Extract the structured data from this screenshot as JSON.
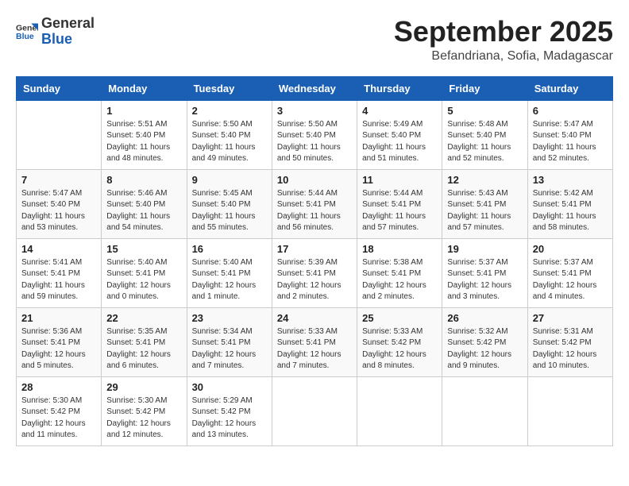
{
  "logo": {
    "general": "General",
    "blue": "Blue"
  },
  "title": "September 2025",
  "subtitle": "Befandriana, Sofia, Madagascar",
  "headers": [
    "Sunday",
    "Monday",
    "Tuesday",
    "Wednesday",
    "Thursday",
    "Friday",
    "Saturday"
  ],
  "weeks": [
    [
      {
        "day": "",
        "info": ""
      },
      {
        "day": "1",
        "info": "Sunrise: 5:51 AM\nSunset: 5:40 PM\nDaylight: 11 hours\nand 48 minutes."
      },
      {
        "day": "2",
        "info": "Sunrise: 5:50 AM\nSunset: 5:40 PM\nDaylight: 11 hours\nand 49 minutes."
      },
      {
        "day": "3",
        "info": "Sunrise: 5:50 AM\nSunset: 5:40 PM\nDaylight: 11 hours\nand 50 minutes."
      },
      {
        "day": "4",
        "info": "Sunrise: 5:49 AM\nSunset: 5:40 PM\nDaylight: 11 hours\nand 51 minutes."
      },
      {
        "day": "5",
        "info": "Sunrise: 5:48 AM\nSunset: 5:40 PM\nDaylight: 11 hours\nand 52 minutes."
      },
      {
        "day": "6",
        "info": "Sunrise: 5:47 AM\nSunset: 5:40 PM\nDaylight: 11 hours\nand 52 minutes."
      }
    ],
    [
      {
        "day": "7",
        "info": "Sunrise: 5:47 AM\nSunset: 5:40 PM\nDaylight: 11 hours\nand 53 minutes."
      },
      {
        "day": "8",
        "info": "Sunrise: 5:46 AM\nSunset: 5:40 PM\nDaylight: 11 hours\nand 54 minutes."
      },
      {
        "day": "9",
        "info": "Sunrise: 5:45 AM\nSunset: 5:40 PM\nDaylight: 11 hours\nand 55 minutes."
      },
      {
        "day": "10",
        "info": "Sunrise: 5:44 AM\nSunset: 5:41 PM\nDaylight: 11 hours\nand 56 minutes."
      },
      {
        "day": "11",
        "info": "Sunrise: 5:44 AM\nSunset: 5:41 PM\nDaylight: 11 hours\nand 57 minutes."
      },
      {
        "day": "12",
        "info": "Sunrise: 5:43 AM\nSunset: 5:41 PM\nDaylight: 11 hours\nand 57 minutes."
      },
      {
        "day": "13",
        "info": "Sunrise: 5:42 AM\nSunset: 5:41 PM\nDaylight: 11 hours\nand 58 minutes."
      }
    ],
    [
      {
        "day": "14",
        "info": "Sunrise: 5:41 AM\nSunset: 5:41 PM\nDaylight: 11 hours\nand 59 minutes."
      },
      {
        "day": "15",
        "info": "Sunrise: 5:40 AM\nSunset: 5:41 PM\nDaylight: 12 hours\nand 0 minutes."
      },
      {
        "day": "16",
        "info": "Sunrise: 5:40 AM\nSunset: 5:41 PM\nDaylight: 12 hours\nand 1 minute."
      },
      {
        "day": "17",
        "info": "Sunrise: 5:39 AM\nSunset: 5:41 PM\nDaylight: 12 hours\nand 2 minutes."
      },
      {
        "day": "18",
        "info": "Sunrise: 5:38 AM\nSunset: 5:41 PM\nDaylight: 12 hours\nand 2 minutes."
      },
      {
        "day": "19",
        "info": "Sunrise: 5:37 AM\nSunset: 5:41 PM\nDaylight: 12 hours\nand 3 minutes."
      },
      {
        "day": "20",
        "info": "Sunrise: 5:37 AM\nSunset: 5:41 PM\nDaylight: 12 hours\nand 4 minutes."
      }
    ],
    [
      {
        "day": "21",
        "info": "Sunrise: 5:36 AM\nSunset: 5:41 PM\nDaylight: 12 hours\nand 5 minutes."
      },
      {
        "day": "22",
        "info": "Sunrise: 5:35 AM\nSunset: 5:41 PM\nDaylight: 12 hours\nand 6 minutes."
      },
      {
        "day": "23",
        "info": "Sunrise: 5:34 AM\nSunset: 5:41 PM\nDaylight: 12 hours\nand 7 minutes."
      },
      {
        "day": "24",
        "info": "Sunrise: 5:33 AM\nSunset: 5:41 PM\nDaylight: 12 hours\nand 7 minutes."
      },
      {
        "day": "25",
        "info": "Sunrise: 5:33 AM\nSunset: 5:42 PM\nDaylight: 12 hours\nand 8 minutes."
      },
      {
        "day": "26",
        "info": "Sunrise: 5:32 AM\nSunset: 5:42 PM\nDaylight: 12 hours\nand 9 minutes."
      },
      {
        "day": "27",
        "info": "Sunrise: 5:31 AM\nSunset: 5:42 PM\nDaylight: 12 hours\nand 10 minutes."
      }
    ],
    [
      {
        "day": "28",
        "info": "Sunrise: 5:30 AM\nSunset: 5:42 PM\nDaylight: 12 hours\nand 11 minutes."
      },
      {
        "day": "29",
        "info": "Sunrise: 5:30 AM\nSunset: 5:42 PM\nDaylight: 12 hours\nand 12 minutes."
      },
      {
        "day": "30",
        "info": "Sunrise: 5:29 AM\nSunset: 5:42 PM\nDaylight: 12 hours\nand 13 minutes."
      },
      {
        "day": "",
        "info": ""
      },
      {
        "day": "",
        "info": ""
      },
      {
        "day": "",
        "info": ""
      },
      {
        "day": "",
        "info": ""
      }
    ]
  ]
}
